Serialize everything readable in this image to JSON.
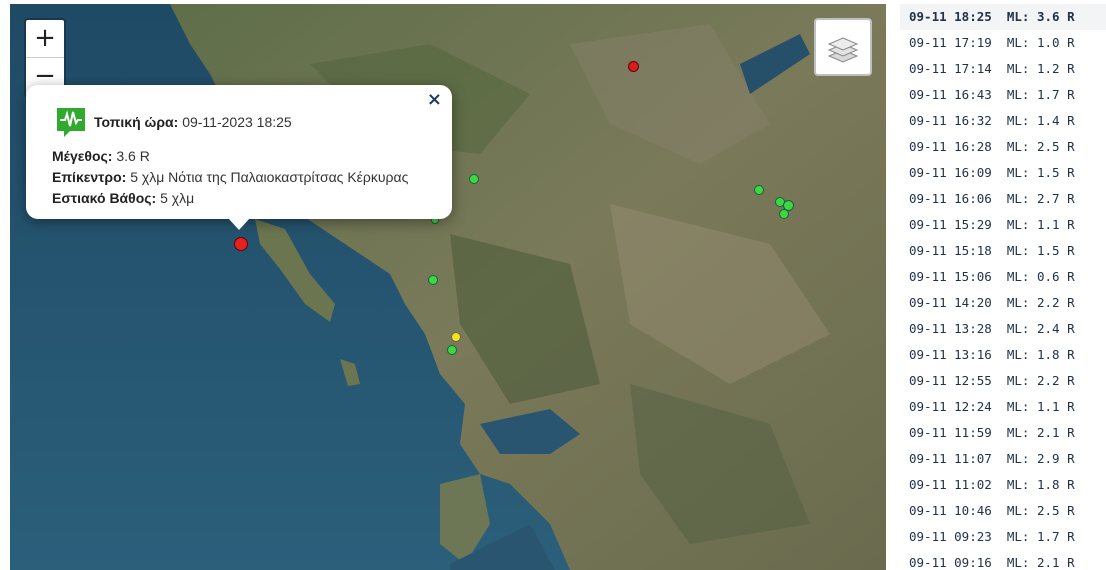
{
  "map": {
    "zoom_in_label": "+",
    "zoom_out_label": "−",
    "layers_icon": "layers-icon",
    "colors": {
      "sea": "#2c5670",
      "land": "#6b7a55",
      "red": "#e52222",
      "green": "#3fd63f",
      "yellow": "#f2e21f"
    }
  },
  "popup": {
    "icon": "seismograph-icon",
    "close_label": "×",
    "time_label": "Τοπική ώρα:",
    "time_value": "09-11-2023 18:25",
    "magnitude_label": "Μέγεθος:",
    "magnitude_value": "3.6 R",
    "epicenter_label": "Επίκεντρο:",
    "epicenter_value": "5 χλμ Νότια της Παλαιοκαστρίτσας Κέρκυρας",
    "depth_label": "Εστιακό Βάθος:",
    "depth_value": "5 χλμ"
  },
  "earthquake_list": [
    {
      "time": "09-11 18:25",
      "magnitude": "ML: 3.6 R"
    },
    {
      "time": "09-11 17:19",
      "magnitude": "ML: 1.0 R"
    },
    {
      "time": "09-11 17:14",
      "magnitude": "ML: 1.2 R"
    },
    {
      "time": "09-11 16:43",
      "magnitude": "ML: 1.7 R"
    },
    {
      "time": "09-11 16:32",
      "magnitude": "ML: 1.4 R"
    },
    {
      "time": "09-11 16:28",
      "magnitude": "ML: 2.5 R"
    },
    {
      "time": "09-11 16:09",
      "magnitude": "ML: 1.5 R"
    },
    {
      "time": "09-11 16:06",
      "magnitude": "ML: 2.7 R"
    },
    {
      "time": "09-11 15:29",
      "magnitude": "ML: 1.1 R"
    },
    {
      "time": "09-11 15:18",
      "magnitude": "ML: 1.5 R"
    },
    {
      "time": "09-11 15:06",
      "magnitude": "ML: 0.6 R"
    },
    {
      "time": "09-11 14:20",
      "magnitude": "ML: 2.2 R"
    },
    {
      "time": "09-11 13:28",
      "magnitude": "ML: 2.4 R"
    },
    {
      "time": "09-11 13:16",
      "magnitude": "ML: 1.8 R"
    },
    {
      "time": "09-11 12:55",
      "magnitude": "ML: 2.2 R"
    },
    {
      "time": "09-11 12:24",
      "magnitude": "ML: 1.1 R"
    },
    {
      "time": "09-11 11:59",
      "magnitude": "ML: 2.1 R"
    },
    {
      "time": "09-11 11:07",
      "magnitude": "ML: 2.9 R"
    },
    {
      "time": "09-11 11:02",
      "magnitude": "ML: 1.8 R"
    },
    {
      "time": "09-11 10:46",
      "magnitude": "ML: 2.5 R"
    },
    {
      "time": "09-11 09:23",
      "magnitude": "ML: 1.7 R"
    },
    {
      "time": "09-11 09:16",
      "magnitude": "ML: 2.1 R"
    }
  ]
}
